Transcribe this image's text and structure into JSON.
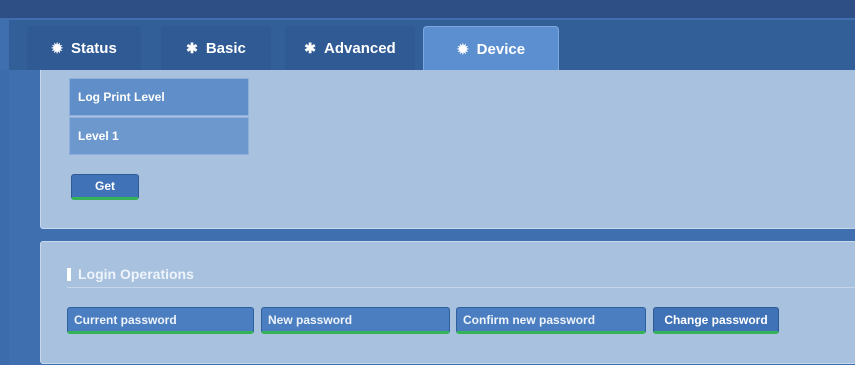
{
  "tabs": [
    {
      "label": "Status",
      "icon": "gear-icon"
    },
    {
      "label": "Basic",
      "icon": "asterisk-icon"
    },
    {
      "label": "Advanced",
      "icon": "asterisk-icon"
    },
    {
      "label": "Device",
      "icon": "gear-icon",
      "active": true
    }
  ],
  "log_panel": {
    "field_label": "Log Print Level",
    "field_value": "Level 1",
    "get_button": "Get"
  },
  "login_panel": {
    "title": "Login Operations",
    "current_password_placeholder": "Current password",
    "new_password_placeholder": "New password",
    "confirm_password_placeholder": "Confirm new password",
    "change_button": "Change password"
  },
  "colors": {
    "accent": "#35b457",
    "panel": "#a8c1de",
    "tab_active": "#5c8fd0"
  }
}
